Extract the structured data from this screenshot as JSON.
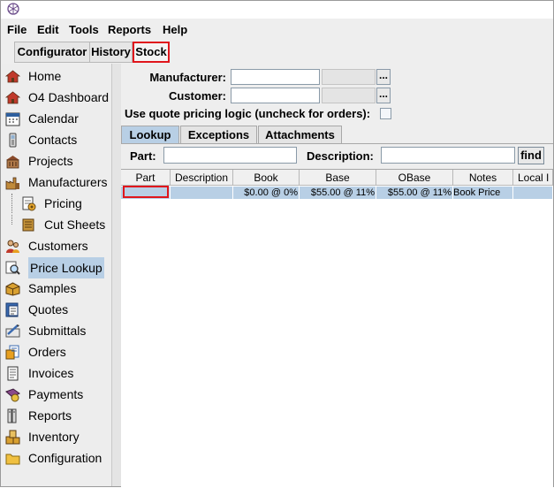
{
  "menu": {
    "items": [
      {
        "id": "file",
        "label": "File"
      },
      {
        "id": "edit",
        "label": "Edit"
      },
      {
        "id": "tools",
        "label": "Tools"
      },
      {
        "id": "reports",
        "label": "Reports"
      },
      {
        "id": "help",
        "label": "Help"
      }
    ]
  },
  "toolbar_tabs": [
    {
      "id": "configurator",
      "label": "Configurator"
    },
    {
      "id": "history",
      "label": "History"
    },
    {
      "id": "stock",
      "label": "Stock",
      "active": true
    }
  ],
  "sidebar": {
    "items": [
      {
        "id": "home",
        "label": "Home",
        "icon": "house-icon"
      },
      {
        "id": "o4-dashboard",
        "label": "O4 Dashboard",
        "icon": "house-icon"
      },
      {
        "id": "calendar",
        "label": "Calendar",
        "icon": "calendar-icon"
      },
      {
        "id": "contacts",
        "label": "Contacts",
        "icon": "phone-icon"
      },
      {
        "id": "projects",
        "label": "Projects",
        "icon": "building-icon"
      },
      {
        "id": "manufacturers",
        "label": "Manufacturers",
        "icon": "factory-icon"
      },
      {
        "id": "pricing",
        "label": "Pricing",
        "icon": "pricing-icon",
        "indent": true
      },
      {
        "id": "cut-sheets",
        "label": "Cut Sheets",
        "icon": "document-stack-icon",
        "indent": true
      },
      {
        "id": "customers",
        "label": "Customers",
        "icon": "people-icon"
      },
      {
        "id": "price-lookup",
        "label": "Price Lookup",
        "icon": "magnifier-icon",
        "selected": true
      },
      {
        "id": "samples",
        "label": "Samples",
        "icon": "box-icon"
      },
      {
        "id": "quotes",
        "label": "Quotes",
        "icon": "quote-icon"
      },
      {
        "id": "submittals",
        "label": "Submittals",
        "icon": "submittal-icon"
      },
      {
        "id": "orders",
        "label": "Orders",
        "icon": "orders-icon"
      },
      {
        "id": "invoices",
        "label": "Invoices",
        "icon": "invoice-icon"
      },
      {
        "id": "payments",
        "label": "Payments",
        "icon": "payment-icon"
      },
      {
        "id": "reports",
        "label": "Reports",
        "icon": "report-icon"
      },
      {
        "id": "inventory",
        "label": "Inventory",
        "icon": "inventory-icon"
      },
      {
        "id": "configuration",
        "label": "Configuration",
        "icon": "folder-icon"
      }
    ]
  },
  "form": {
    "manufacturer_label": "Manufacturer:",
    "manufacturer_value": "",
    "customer_label": "Customer:",
    "customer_value": "",
    "ellipsis_label": "...",
    "quote_logic_label": "Use quote pricing logic (uncheck for orders):",
    "quote_logic_checked": false
  },
  "tabs": [
    {
      "id": "lookup",
      "label": "Lookup",
      "active": true
    },
    {
      "id": "exceptions",
      "label": "Exceptions"
    },
    {
      "id": "attachments",
      "label": "Attachments"
    }
  ],
  "search": {
    "part_label": "Part:",
    "part_value": "",
    "description_label": "Description:",
    "description_value": "",
    "find_label": "find"
  },
  "grid": {
    "columns": [
      "Part",
      "Description",
      "Book",
      "Base",
      "OBase",
      "Notes",
      "Local I"
    ],
    "rows": [
      {
        "part": "",
        "description": "",
        "book": "$0.00 @ 0%",
        "base": "$55.00 @ 11%",
        "obase": "$55.00 @ 11%",
        "notes": "Book Price",
        "local": ""
      }
    ]
  },
  "colors": {
    "highlight_red": "#e0161c",
    "selection_blue": "#b8cfe5"
  }
}
